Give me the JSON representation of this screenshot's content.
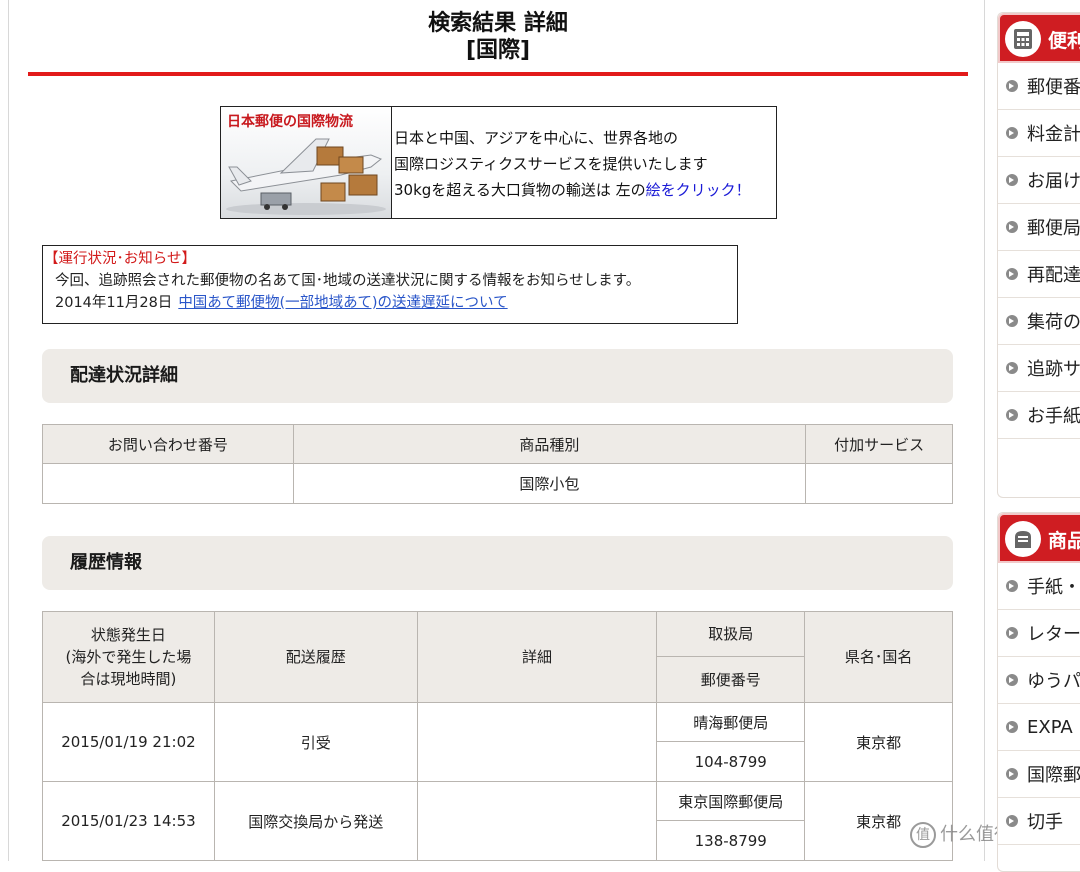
{
  "header": {
    "title_line1": "検索結果 詳細",
    "title_line2": "[国際]"
  },
  "banner": {
    "image_title": "日本郵便の国際物流",
    "line1": "日本と中国、アジアを中心に、世界各地の",
    "line2": "国際ロジスティクスサービスを提供いたします",
    "line3_prefix": "30kgを超える大口貨物の輸送は 左の",
    "line3_link": "絵をクリック！"
  },
  "notice": {
    "heading": "【運行状況･お知らせ】",
    "body": "今回、追跡照会された郵便物の名あて国･地域の送達状況に関する情報をお知らせします。",
    "date": "2014年11月28日",
    "link": "中国あて郵便物(一部地域あて)の送達遅延について"
  },
  "delivery_section": {
    "title": "配達状況詳細",
    "headers": [
      "お問い合わせ番号",
      "商品種別",
      "付加サービス"
    ],
    "row": [
      "",
      "国際小包",
      ""
    ]
  },
  "history_section": {
    "title": "履歴情報",
    "headers": {
      "date": "状態発生日\n(海外で発生した場\n合は現地時間)",
      "history": "配送履歴",
      "detail": "詳細",
      "office": "取扱局",
      "postal": "郵便番号",
      "region": "県名･国名"
    },
    "rows": [
      {
        "date": "2015/01/19 21:02",
        "history": "引受",
        "detail": "",
        "office": "晴海郵便局",
        "postal": "104-8799",
        "region": "東京都"
      },
      {
        "date": "2015/01/23 14:53",
        "history": "国際交換局から発送",
        "detail": "",
        "office": "東京国際郵便局",
        "postal": "138-8799",
        "region": "東京都"
      }
    ]
  },
  "sidebar": {
    "panel1": {
      "title": "便利",
      "icon": "calculator-icon",
      "items": [
        "郵便番号",
        "料金計",
        "お届け",
        "郵便局",
        "再配達",
        "集荷の",
        "追跡サ",
        "お手紙"
      ]
    },
    "panel2": {
      "title": "商品",
      "icon": "mailbox-icon",
      "items": [
        "手紙・",
        "レター",
        "ゆうパ",
        "EXPA",
        "国際郵",
        "切手"
      ]
    }
  },
  "watermark": {
    "glyph": "值",
    "text": "什么值得买"
  },
  "colors": {
    "accent_red": "#e21a1a",
    "header_bg": "#eeebe7",
    "link_blue": "#2a56c9"
  }
}
